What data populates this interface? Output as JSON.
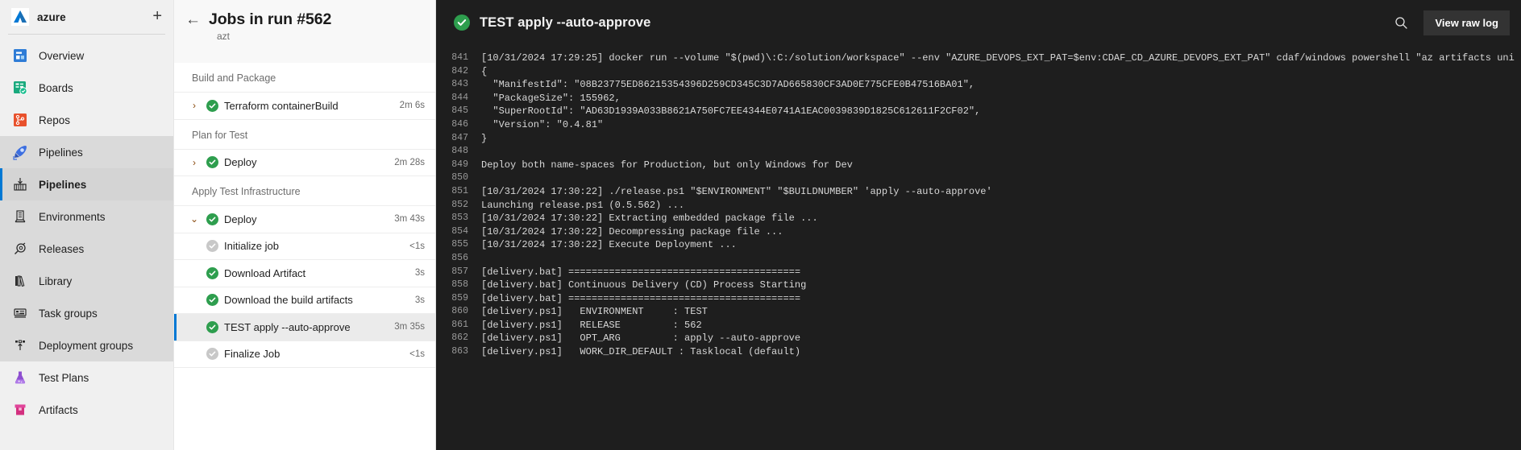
{
  "sidebar": {
    "org": {
      "name": "azure",
      "add_label": "+",
      "logo_icon": "azure-devops-logo"
    },
    "items": [
      {
        "label": "Overview",
        "icon": "overview-icon",
        "state": "normal"
      },
      {
        "label": "Boards",
        "icon": "boards-icon",
        "state": "normal"
      },
      {
        "label": "Repos",
        "icon": "repos-icon",
        "state": "normal"
      },
      {
        "label": "Pipelines",
        "icon": "pipelines-rocket-icon",
        "state": "group"
      },
      {
        "label": "Pipelines",
        "icon": "pipeline-run-icon",
        "state": "selected"
      },
      {
        "label": "Environments",
        "icon": "environments-icon",
        "state": "group"
      },
      {
        "label": "Releases",
        "icon": "releases-icon",
        "state": "group"
      },
      {
        "label": "Library",
        "icon": "library-icon",
        "state": "group"
      },
      {
        "label": "Task groups",
        "icon": "task-groups-icon",
        "state": "group"
      },
      {
        "label": "Deployment groups",
        "icon": "deployment-groups-icon",
        "state": "group"
      },
      {
        "label": "Test Plans",
        "icon": "test-plans-icon",
        "state": "normal"
      },
      {
        "label": "Artifacts",
        "icon": "artifacts-icon",
        "state": "normal"
      }
    ]
  },
  "jobs_panel": {
    "back_label": "←",
    "title": "Jobs in run #562",
    "subtitle": "azt",
    "rows": [
      {
        "kind": "stage",
        "label": "Build and Package"
      },
      {
        "kind": "job",
        "label": "Terraform containerBuild",
        "duration": "2m 6s",
        "status": "success",
        "chevron": "›",
        "selected": false
      },
      {
        "kind": "stage",
        "label": "Plan for Test"
      },
      {
        "kind": "job",
        "label": "Deploy",
        "duration": "2m 28s",
        "status": "success",
        "chevron": "›",
        "selected": false
      },
      {
        "kind": "stage",
        "label": "Apply Test Infrastructure"
      },
      {
        "kind": "job",
        "label": "Deploy",
        "duration": "3m 43s",
        "status": "success",
        "chevron": "⌄",
        "selected": false
      },
      {
        "kind": "task",
        "label": "Initialize job",
        "duration": "<1s",
        "status": "skipped",
        "selected": false
      },
      {
        "kind": "task",
        "label": "Download Artifact",
        "duration": "3s",
        "status": "success",
        "selected": false
      },
      {
        "kind": "task",
        "label": "Download the build artifacts",
        "duration": "3s",
        "status": "success",
        "selected": false
      },
      {
        "kind": "task",
        "label": "TEST apply --auto-approve",
        "duration": "3m 35s",
        "status": "success",
        "selected": true
      },
      {
        "kind": "task",
        "label": "Finalize Job",
        "duration": "<1s",
        "status": "skipped",
        "selected": false
      }
    ]
  },
  "log_panel": {
    "status": "success",
    "title": "TEST apply --auto-approve",
    "search_icon": "search-icon",
    "view_raw_log_label": "View raw log",
    "first_line_number": 841,
    "lines": [
      "[10/31/2024 17:29:25] docker run --volume \"$(pwd)\\:C:/solution/workspace\" --env \"AZURE_DEVOPS_EXT_PAT=$env:CDAF_CD_AZURE_DEVOPS_EXT_PAT\" cdaf/windows powershell \"az artifacts uni",
      "{",
      "  \"ManifestId\": \"08B23775ED86215354396D259CD345C3D7AD665830CF3AD0E775CFE0B47516BA01\",",
      "  \"PackageSize\": 155962,",
      "  \"SuperRootId\": \"AD63D1939A033B8621A750FC7EE4344E0741A1EAC0039839D1825C612611F2CF02\",",
      "  \"Version\": \"0.4.81\"",
      "}",
      "",
      "Deploy both name-spaces for Production, but only Windows for Dev",
      "",
      "[10/31/2024 17:30:22] ./release.ps1 \"$ENVIRONMENT\" \"$BUILDNUMBER\" 'apply --auto-approve'",
      "Launching release.ps1 (0.5.562) ...",
      "[10/31/2024 17:30:22] Extracting embedded package file ...",
      "[10/31/2024 17:30:22] Decompressing package file ...",
      "[10/31/2024 17:30:22] Execute Deployment ...",
      "",
      "[delivery.bat] ========================================",
      "[delivery.bat] Continuous Delivery (CD) Process Starting",
      "[delivery.bat] ========================================",
      "[delivery.ps1]   ENVIRONMENT     : TEST",
      "[delivery.ps1]   RELEASE         : 562",
      "[delivery.ps1]   OPT_ARG         : apply --auto-approve",
      "[delivery.ps1]   WORK_DIR_DEFAULT : Tasklocal (default)"
    ]
  },
  "colors": {
    "accent": "#0078d4",
    "success": "#2e9e4e",
    "skipped": "#c8c8c8",
    "log_bg": "#1e1e1e",
    "sidebar_bg": "#f0f0f0"
  }
}
